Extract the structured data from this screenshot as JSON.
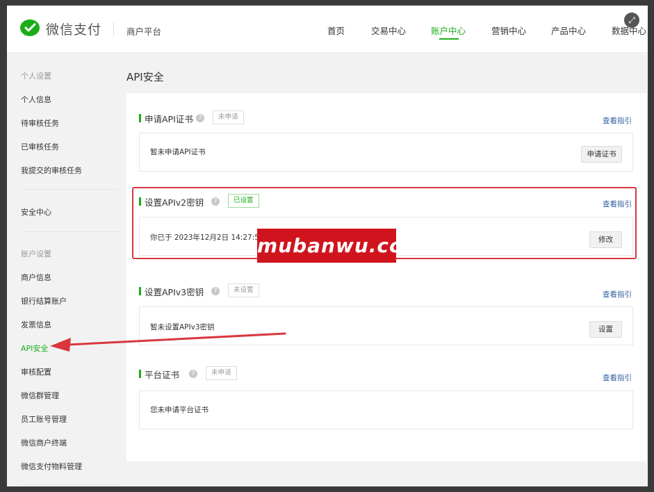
{
  "header": {
    "brand": "微信支付",
    "platform": "商户平台",
    "nav": [
      "首页",
      "交易中心",
      "账户中心",
      "营销中心",
      "产品中心",
      "数据中心"
    ],
    "active_nav": "账户中心"
  },
  "sidebar": {
    "group_personal": "个人设置",
    "personal_items": [
      "个人信息",
      "待审核任务",
      "已审核任务",
      "我提交的审核任务"
    ],
    "security_center": "安全中心",
    "group_account": "账户设置",
    "account_items": [
      "商户信息",
      "银行结算账户",
      "发票信息",
      "API安全",
      "审核配置",
      "微信群管理",
      "员工账号管理",
      "微信商户终端",
      "微信支付物料管理"
    ],
    "active_item": "API安全"
  },
  "main": {
    "page_title": "API安全",
    "sections": [
      {
        "title": "申请API证书",
        "badge": "未申请",
        "guide": "查看指引",
        "content": "暂未申请API证书",
        "button": "申请证书"
      },
      {
        "title": "设置APIv2密钥",
        "badge": "已设置",
        "guide": "查看指引",
        "content": "你已于 2023年12月2日 14:27:55",
        "button": "修改"
      },
      {
        "title": "设置APIv3密钥",
        "badge": "未设置",
        "guide": "查看指引",
        "content": "暂未设置APIv3密钥",
        "button": "设置"
      },
      {
        "title": "平台证书",
        "badge": "未申请",
        "guide": "查看指引",
        "content": "您未申请平台证书",
        "button": ""
      }
    ]
  },
  "watermark": "mubanwu.cc",
  "colors": {
    "accent": "#1aad19",
    "highlight": "#d9363e",
    "link": "#2f5c9c",
    "watermark_bg": "#d0141e"
  },
  "icons": {
    "logo": "wechat-pay-logo",
    "help": "question-circle-icon",
    "close": "expand-close-icon"
  }
}
